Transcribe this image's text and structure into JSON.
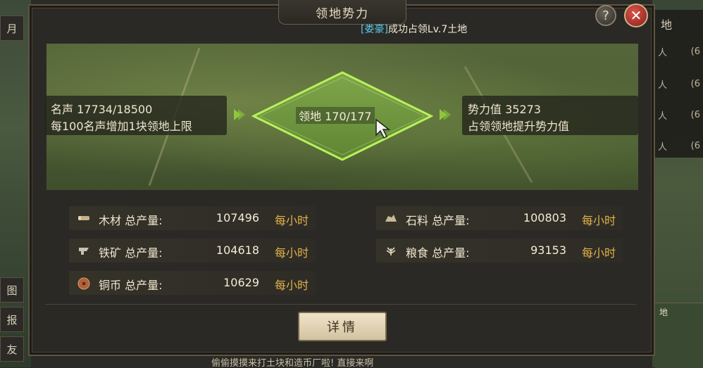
{
  "background": {
    "left_tabs": [
      "月",
      "图",
      "报",
      "友"
    ],
    "right_panel": {
      "header": "地",
      "rows": [
        {
          "left": "人",
          "right": "(6"
        },
        {
          "left": "人",
          "right": "(6"
        },
        {
          "left": "人",
          "right": "(6"
        },
        {
          "left": "人",
          "right": "(6"
        }
      ]
    },
    "minimap_label": "地",
    "bottom_ticker": "偷偷摸摸来打土块和造币厂啦! 直接来啊"
  },
  "dialog": {
    "title": "领地势力",
    "help_label": "?",
    "close_label": "✕",
    "notice_tag": "[娄豪]",
    "notice_text": "成功占领Lv.7土地"
  },
  "overview": {
    "fame_line": "名声 17734/18500",
    "fame_desc": "每100名声增加1块领地上限",
    "territory_line": "领地 170/177",
    "power_line": "势力值 35273",
    "power_desc": "占领领地提升势力值"
  },
  "production": [
    {
      "name": "木材 总产量:",
      "value": "107496",
      "unit": "每小时",
      "icon": "wood-icon"
    },
    {
      "name": "石料 总产量:",
      "value": "100803",
      "unit": "每小时",
      "icon": "stone-icon"
    },
    {
      "name": "铁矿 总产量:",
      "value": "104618",
      "unit": "每小时",
      "icon": "iron-icon"
    },
    {
      "name": "粮食 总产量:",
      "value": "93153",
      "unit": "每小时",
      "icon": "grain-icon"
    },
    {
      "name": "铜币 总产量:",
      "value": "10629",
      "unit": "每小时",
      "icon": "copper-coin-icon"
    }
  ],
  "detail_button": "详情",
  "colors": {
    "accent_green": "#8cc83a",
    "unit_gold": "#e2b24a",
    "notice_tag_blue": "#58c6e8",
    "close_red": "#c23a30"
  }
}
